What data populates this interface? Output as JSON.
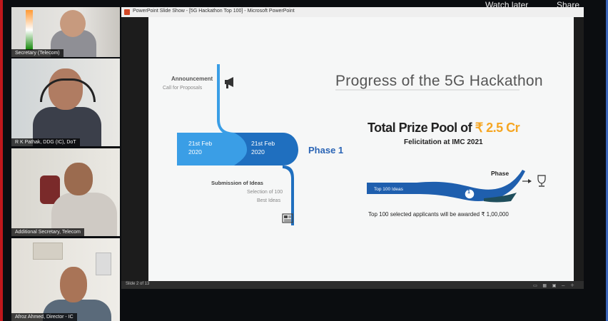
{
  "overlay": {
    "watch_later": "Watch later",
    "share": "Share"
  },
  "participants": [
    {
      "name": "Secretary (Telecom)"
    },
    {
      "name": "R K Pathak, DDG (IC), DoT"
    },
    {
      "name": "Additional Secretary, Telecom"
    },
    {
      "name": "Afroz Ahmed, Director - IC"
    }
  ],
  "powerpoint": {
    "window_title": "PowerPoint Slide Show - [5G Hackathon Top 100] - Microsoft PowerPoint",
    "status_text": "Slide 2 of 13"
  },
  "slide": {
    "title": "Progress of the 5G Hackathon",
    "announcement": "Announcement",
    "call_for_proposals": "Call for Proposals",
    "date1_day": "21st Feb",
    "date1_year": "2020",
    "date2_day": "21st Feb",
    "date2_year": "2020",
    "phase1": "Phase 1",
    "submission": "Submission of Ideas",
    "selection_line1": "Selection of 100",
    "selection_line2": "Best Ideas",
    "prize_prefix": "Total Prize Pool of",
    "prize_amount": "₹ 2.5 Cr",
    "felicitation": "Felicitation at IMC 2021",
    "phase_label": "Phase",
    "top100_label": "Top 100 Ideas",
    "phase_number": "1",
    "awarded_text": "Top 100 selected applicants will be awarded ₹ 1,00,000"
  },
  "colors": {
    "accent_blue": "#2a64b5",
    "light_blue": "#3a9ee6",
    "prize_orange": "#f5a623",
    "dark_teal": "#1f4e5c"
  },
  "icons": [
    "megaphone-icon",
    "newspaper-icon",
    "trophy-icon",
    "arrow-right-icon"
  ]
}
